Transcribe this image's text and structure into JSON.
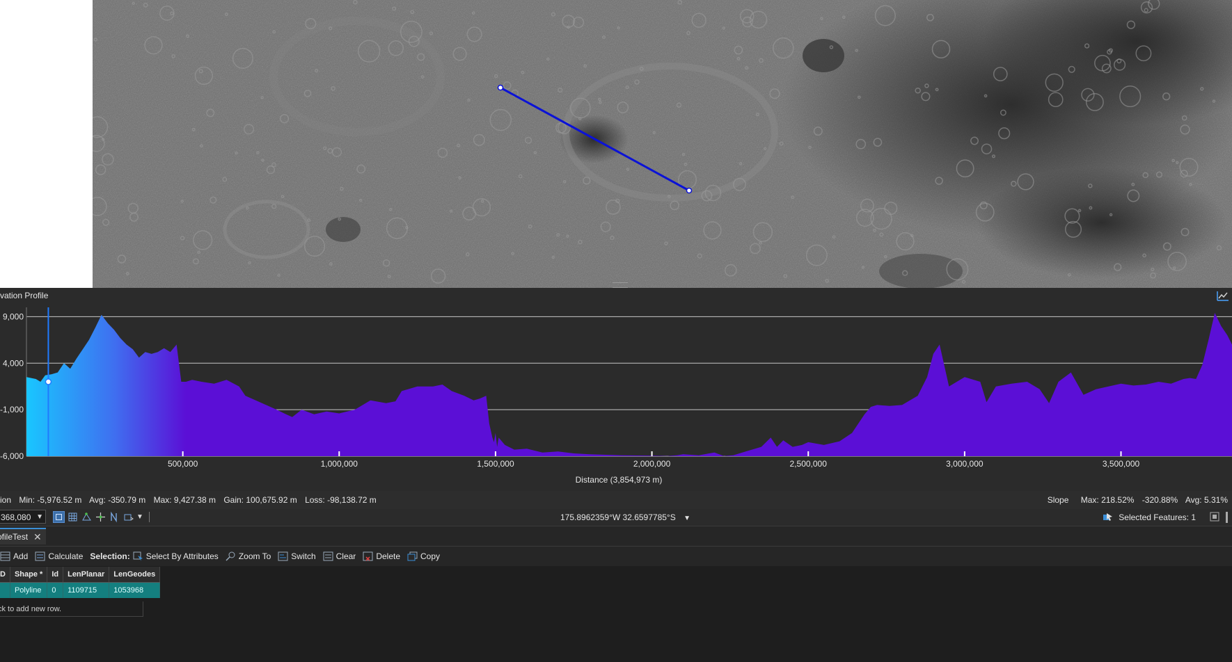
{
  "map": {
    "line_color": "#0b12d6"
  },
  "profile": {
    "title": "vation Profile",
    "x_axis_label": "Distance (3,854,973 m)",
    "colors": {
      "fill_start": "#19c6ff",
      "fill_end": "#5b0fd6",
      "background": "#2b2b2b",
      "grid": "#c8c8c8"
    }
  },
  "chart_data": {
    "type": "area",
    "xlabel": "Distance (3,854,973 m)",
    "ylabel": "",
    "xlim": [
      0,
      3854973
    ],
    "ylim": [
      -6000,
      10000
    ],
    "x_ticks": [
      500000,
      1000000,
      1500000,
      2000000,
      2500000,
      3000000,
      3500000
    ],
    "x_tick_labels": [
      "500,000",
      "1,000,000",
      "1,500,000",
      "2,000,000",
      "2,500,000",
      "3,000,000",
      "3,500,000"
    ],
    "y_ticks": [
      9000,
      4000,
      -1000,
      -6000
    ],
    "y_tick_labels": [
      "9,000",
      "4,000",
      "-1,000",
      "-6,000"
    ],
    "grid": true,
    "cursor_x": 70000,
    "cursor_y": 2000,
    "series": [
      {
        "x": [
          0,
          30000,
          45000,
          60000,
          80000,
          100000,
          120000,
          140000,
          160000,
          180000,
          200000,
          220000,
          240000,
          260000,
          280000,
          300000,
          320000,
          340000,
          360000,
          380000,
          400000,
          420000,
          440000,
          460000,
          480000,
          495000,
          510000,
          530000,
          560000,
          600000,
          640000,
          680000,
          700000,
          720000,
          760000,
          800000,
          830000,
          850000,
          880000,
          920000,
          960000,
          1000000,
          1050000,
          1100000,
          1150000,
          1180000,
          1200000,
          1250000,
          1300000,
          1330000,
          1360000,
          1400000,
          1430000,
          1450000,
          1470000,
          1480000,
          1490000,
          1495000,
          1500000,
          1505000,
          1510000,
          1530000,
          1560000,
          1600000,
          1650000,
          1700000,
          1750000,
          1800000,
          1900000,
          2000000,
          2050000,
          2080000,
          2100000,
          2150000,
          2200000,
          2230000,
          2260000,
          2300000,
          2350000,
          2380000,
          2400000,
          2420000,
          2450000,
          2480000,
          2500000,
          2550000,
          2600000,
          2640000,
          2680000,
          2700000,
          2720000,
          2760000,
          2800000,
          2850000,
          2880000,
          2900000,
          2920000,
          2950000,
          3000000,
          3050000,
          3070000,
          3100000,
          3150000,
          3200000,
          3240000,
          3270000,
          3300000,
          3340000,
          3380000,
          3420000,
          3460000,
          3500000,
          3540000,
          3580000,
          3620000,
          3660000,
          3700000,
          3720000,
          3740000,
          3760000,
          3780000,
          3800000,
          3820000,
          3840000,
          3854973
        ],
        "values": [
          2500,
          2300,
          2000,
          2700,
          2800,
          3000,
          4000,
          3400,
          4500,
          5500,
          6500,
          7800,
          9200,
          8300,
          7600,
          6700,
          6000,
          5500,
          4600,
          5200,
          5000,
          5200,
          5600,
          5200,
          6000,
          2000,
          2000,
          2200,
          2000,
          1800,
          2200,
          1500,
          500,
          200,
          -400,
          -1000,
          -1500,
          -1800,
          -1000,
          -1500,
          -1200,
          -1400,
          -1000,
          0,
          -300,
          -100,
          1000,
          1500,
          1500,
          1700,
          1000,
          500,
          0,
          200,
          500,
          -2500,
          -4000,
          -4500,
          -3500,
          -5000,
          -4000,
          -4800,
          -5300,
          -5200,
          -5600,
          -5500,
          -5700,
          -5800,
          -5900,
          -5950,
          -5976,
          -5900,
          -5800,
          -5900,
          -5600,
          -5976,
          -5900,
          -5500,
          -5000,
          -4000,
          -5000,
          -4300,
          -5000,
          -4800,
          -4500,
          -4800,
          -4400,
          -3500,
          -1500,
          -700,
          -500,
          -600,
          -500,
          500,
          2500,
          5000,
          6000,
          1500,
          2500,
          2000,
          -200,
          1500,
          1800,
          2000,
          1200,
          -300,
          2000,
          3000,
          600,
          1200,
          1500,
          1800,
          1600,
          1700,
          2000,
          1800,
          2300,
          2400,
          2300,
          3800,
          6500,
          9400,
          8000,
          7000,
          6000
        ],
        "name": ""
      }
    ]
  },
  "stats": {
    "left": [
      "ion",
      "Min: -5,976.52 m",
      "Avg: -350.79 m",
      "Max: 9,427.38 m",
      "Gain: 100,675.92 m",
      "Loss: -98,138.72 m"
    ],
    "right": [
      "Slope",
      "Max: 218.52%",
      "-320.88%",
      "Avg: 5.31%"
    ]
  },
  "status": {
    "scale": "368,080",
    "coordinates": "175.8962359°W 32.6597785°S",
    "selected_features": "Selected Features: 1"
  },
  "tab": {
    "label": "ofileTest"
  },
  "toolbar": {
    "add": "Add",
    "calculate": "Calculate",
    "selection": "Selection:",
    "select_by_attributes": "Select By Attributes",
    "zoom_to": "Zoom To",
    "switch": "Switch",
    "clear": "Clear",
    "delete": "Delete",
    "copy": "Copy"
  },
  "table": {
    "columns": [
      "D",
      "Shape *",
      "Id",
      "LenPlanar",
      "LenGeodes"
    ],
    "rows": [
      [
        "",
        "Polyline",
        "0",
        "1109715",
        "1053968"
      ]
    ],
    "add_row_text": "ck to add new row."
  }
}
